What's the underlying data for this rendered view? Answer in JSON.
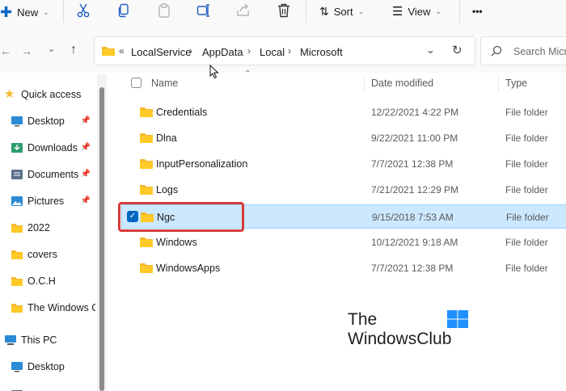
{
  "toolbar": {
    "new_label": "New",
    "sort_label": "Sort",
    "view_label": "View",
    "more_label": "•••"
  },
  "address_bar": {
    "overflow": "«",
    "crumbs": [
      "LocalService",
      "AppData",
      "Local",
      "Microsoft"
    ]
  },
  "search": {
    "placeholder": "Search Micro"
  },
  "sidebar": {
    "items": [
      {
        "label": "Quick access",
        "icon": "star-icon"
      },
      {
        "label": "Desktop",
        "icon": "desktop-icon",
        "pinned": true
      },
      {
        "label": "Downloads",
        "icon": "downloads-icon",
        "pinned": true
      },
      {
        "label": "Documents",
        "icon": "documents-icon",
        "pinned": true
      },
      {
        "label": "Pictures",
        "icon": "pictures-icon",
        "pinned": true
      },
      {
        "label": "2022",
        "icon": "folder-icon"
      },
      {
        "label": "covers",
        "icon": "folder-icon"
      },
      {
        "label": "O.C.H",
        "icon": "folder-icon"
      },
      {
        "label": "The Windows C",
        "icon": "folder-icon"
      },
      {
        "label": "This PC",
        "icon": "pc-icon"
      },
      {
        "label": "Desktop",
        "icon": "desktop-icon"
      }
    ]
  },
  "columns": {
    "name": "Name",
    "date": "Date modified",
    "type": "Type"
  },
  "files": [
    {
      "name": "Credentials",
      "date": "12/22/2021 4:22 PM",
      "type": "File folder"
    },
    {
      "name": "Dlna",
      "date": "9/22/2021 11:00 PM",
      "type": "File folder"
    },
    {
      "name": "InputPersonalization",
      "date": "7/7/2021 12:38 PM",
      "type": "File folder"
    },
    {
      "name": "Logs",
      "date": "7/21/2021 12:29 PM",
      "type": "File folder"
    },
    {
      "name": "Ngc",
      "date": "9/15/2018 7:53 AM",
      "type": "File folder",
      "selected": true
    },
    {
      "name": "Windows",
      "date": "10/12/2021 9:18 AM",
      "type": "File folder"
    },
    {
      "name": "WindowsApps",
      "date": "7/7/2021 12:38 PM",
      "type": "File folder"
    }
  ],
  "watermark": {
    "line1": "The",
    "line2": "WindowsClub"
  },
  "colors": {
    "folder": "#ffca28",
    "selection": "#cce8ff",
    "highlight": "#d83a3a",
    "accent": "#0067c0"
  }
}
